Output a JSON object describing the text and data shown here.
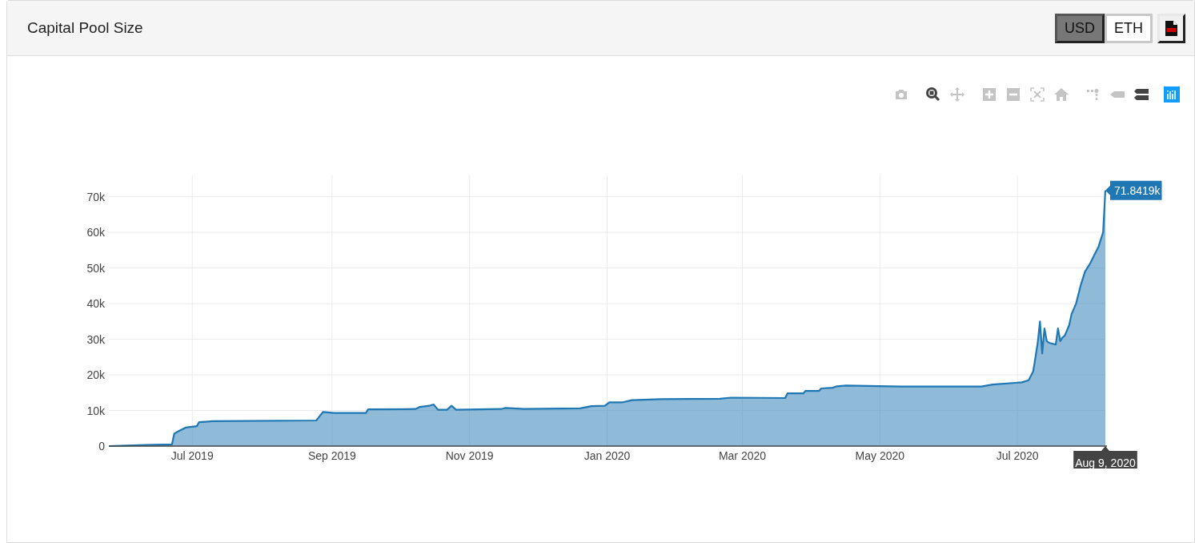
{
  "card": {
    "title": "Capital Pool Size",
    "currency_toggle": [
      {
        "label": "USD",
        "selected": true
      },
      {
        "label": "ETH",
        "selected": false
      }
    ],
    "export_button": {
      "kind": "csv"
    }
  },
  "modebar": [
    {
      "kind": "camera",
      "active": false
    },
    {
      "kind": "zoom",
      "active": true
    },
    {
      "kind": "pan",
      "active": false
    },
    {
      "kind": "zoom-in",
      "active": false
    },
    {
      "kind": "zoom-out",
      "active": false
    },
    {
      "kind": "autoscale",
      "active": false
    },
    {
      "kind": "home",
      "active": false
    },
    {
      "kind": "spikelines",
      "active": false
    },
    {
      "kind": "hover-closest",
      "active": false
    },
    {
      "kind": "hover-compare",
      "active": true
    }
  ],
  "chart_data": {
    "type": "area",
    "grid": true,
    "xlim": [
      "2019-05-25",
      "2020-08-09"
    ],
    "ylim": [
      0,
      76000
    ],
    "xticks": [
      {
        "value": "2019-07-01",
        "label": "Jul 2019"
      },
      {
        "value": "2019-09-01",
        "label": "Sep 2019"
      },
      {
        "value": "2019-11-01",
        "label": "Nov 2019"
      },
      {
        "value": "2020-01-01",
        "label": "Jan 2020"
      },
      {
        "value": "2020-03-01",
        "label": "Mar 2020"
      },
      {
        "value": "2020-05-01",
        "label": "May 2020"
      },
      {
        "value": "2020-07-01",
        "label": "Jul 2020"
      }
    ],
    "yticks": [
      {
        "value": 0,
        "label": "0"
      },
      {
        "value": 10000,
        "label": "10k"
      },
      {
        "value": 20000,
        "label": "20k"
      },
      {
        "value": 30000,
        "label": "30k"
      },
      {
        "value": 40000,
        "label": "40k"
      },
      {
        "value": 50000,
        "label": "50k"
      },
      {
        "value": 60000,
        "label": "60k"
      },
      {
        "value": 70000,
        "label": "70k"
      }
    ],
    "x": [
      "2019-05-25",
      "2019-06-10",
      "2019-06-22",
      "2019-06-23",
      "2019-06-25",
      "2019-06-28",
      "2019-07-03",
      "2019-07-04",
      "2019-07-10",
      "2019-08-25",
      "2019-08-26",
      "2019-08-28",
      "2019-09-02",
      "2019-09-16",
      "2019-09-17",
      "2019-10-08",
      "2019-10-10",
      "2019-10-14",
      "2019-10-16",
      "2019-10-18",
      "2019-10-22",
      "2019-10-24",
      "2019-10-26",
      "2019-11-15",
      "2019-11-17",
      "2019-11-25",
      "2019-12-20",
      "2019-12-25",
      "2019-12-31",
      "2020-01-02",
      "2020-01-08",
      "2020-01-12",
      "2020-01-25",
      "2020-02-20",
      "2020-02-25",
      "2020-03-20",
      "2020-03-21",
      "2020-03-28",
      "2020-03-29",
      "2020-04-04",
      "2020-04-05",
      "2020-04-10",
      "2020-04-12",
      "2020-04-16",
      "2020-05-10",
      "2020-06-15",
      "2020-06-20",
      "2020-07-03",
      "2020-07-06",
      "2020-07-08",
      "2020-07-10",
      "2020-07-11",
      "2020-07-12",
      "2020-07-13",
      "2020-07-14",
      "2020-07-15",
      "2020-07-18",
      "2020-07-19",
      "2020-07-20",
      "2020-07-21",
      "2020-07-22",
      "2020-07-24",
      "2020-07-25",
      "2020-07-27",
      "2020-07-29",
      "2020-07-31",
      "2020-08-02",
      "2020-08-04",
      "2020-08-06",
      "2020-08-08",
      "2020-08-09"
    ],
    "series": [
      {
        "color": "#1f77b4",
        "values": [
          0,
          300,
          500,
          3500,
          4200,
          5200,
          5600,
          6700,
          7000,
          7200,
          8000,
          9600,
          9300,
          9300,
          10300,
          10400,
          11000,
          11300,
          11700,
          10200,
          10200,
          11300,
          10200,
          10400,
          10700,
          10400,
          10600,
          11200,
          11300,
          12300,
          12300,
          12900,
          13200,
          13300,
          13600,
          13500,
          14800,
          14800,
          15500,
          15500,
          16200,
          16400,
          16800,
          17000,
          16700,
          16700,
          17300,
          17900,
          18500,
          21000,
          29000,
          35000,
          26000,
          33000,
          29500,
          29000,
          28500,
          33000,
          29500,
          30500,
          31000,
          34000,
          37000,
          40000,
          45000,
          49000,
          51000,
          53500,
          56000,
          60000,
          71800
        ]
      }
    ],
    "annotations": [
      {
        "text": "71.8419k",
        "x": "2020-08-09",
        "y": 71800
      },
      "Aug 9, 2020"
    ]
  }
}
